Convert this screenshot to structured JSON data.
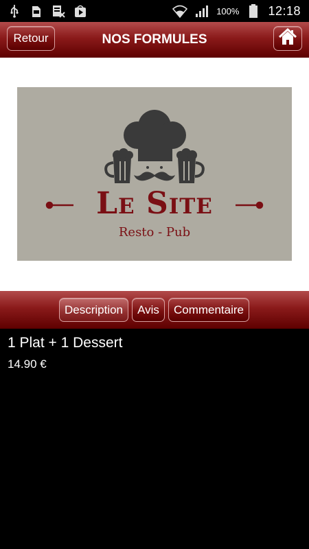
{
  "status_bar": {
    "battery_percent": "100%",
    "time": "12:18",
    "icons": [
      "usb-icon",
      "sd-card-icon",
      "no-sim-icon",
      "play-store-icon",
      "wifi-icon",
      "signal-icon",
      "battery-icon"
    ]
  },
  "header": {
    "back_label": "Retour",
    "title": "NOS FORMULES",
    "home_icon": "home-icon"
  },
  "logo": {
    "name": "Le Site",
    "tagline": "Resto - Pub"
  },
  "tabs": [
    {
      "label": "Description",
      "active": true
    },
    {
      "label": "Avis",
      "active": false
    },
    {
      "label": "Commentaire",
      "active": false
    }
  ],
  "formula": {
    "name": "1 Plat + 1 Dessert",
    "price": "14.90 €"
  },
  "colors": {
    "header_dark": "#5e0000",
    "header_light": "#b24b4b",
    "logo_background": "#aeaba1",
    "logo_text": "#7a0f14",
    "content_background": "#000000"
  }
}
